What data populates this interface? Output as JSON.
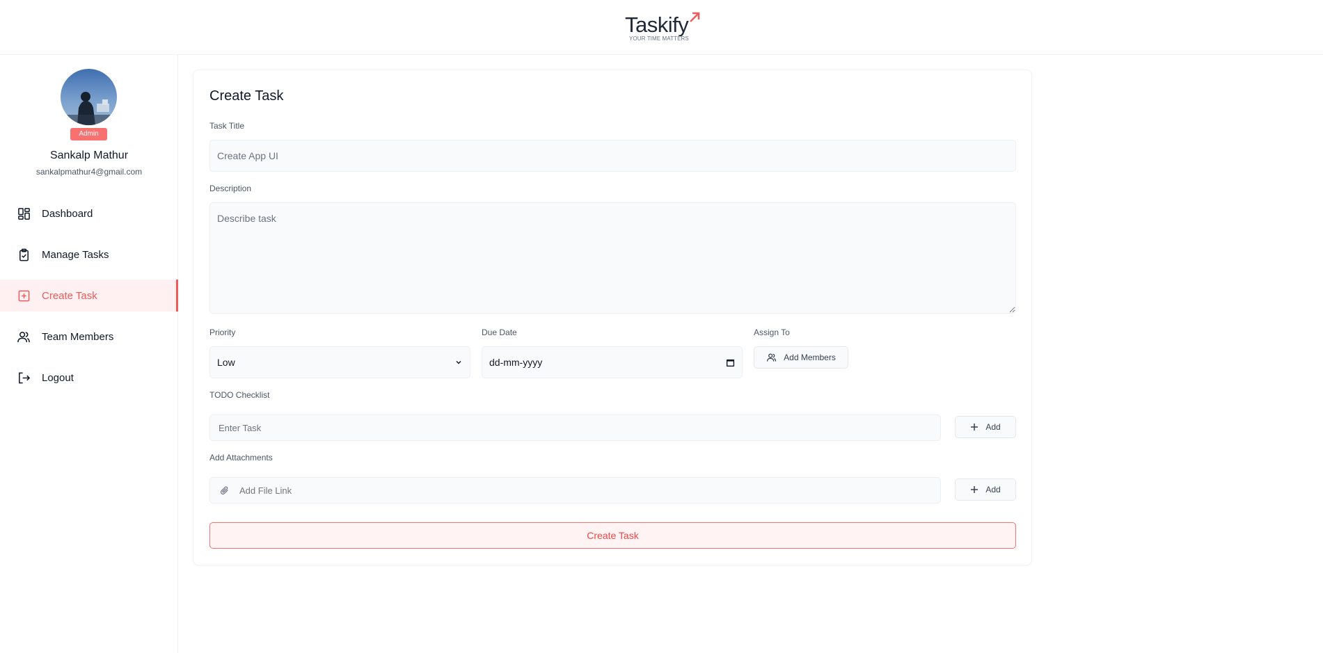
{
  "brand": {
    "name": "Taskify",
    "tagline": "YOUR TIME MATTERS",
    "accent_color": "#f15a5a"
  },
  "user": {
    "role": "Admin",
    "name": "Sankalp Mathur",
    "email": "sankalpmathur4@gmail.com"
  },
  "sidebar": {
    "items": [
      {
        "label": "Dashboard",
        "icon": "dashboard-icon",
        "active": false
      },
      {
        "label": "Manage Tasks",
        "icon": "clipboard-check-icon",
        "active": false
      },
      {
        "label": "Create Task",
        "icon": "plus-square-icon",
        "active": true
      },
      {
        "label": "Team Members",
        "icon": "users-icon",
        "active": false
      },
      {
        "label": "Logout",
        "icon": "logout-icon",
        "active": false
      }
    ]
  },
  "form": {
    "title": "Create Task",
    "task_title": {
      "label": "Task Title",
      "placeholder": "Create App UI",
      "value": ""
    },
    "description": {
      "label": "Description",
      "placeholder": "Describe task",
      "value": ""
    },
    "priority": {
      "label": "Priority",
      "value": "Low"
    },
    "due_date": {
      "label": "Due Date",
      "placeholder": "dd-mm-yyyy"
    },
    "assign_to": {
      "label": "Assign To",
      "button": "Add Members"
    },
    "todo": {
      "label": "TODO Checklist",
      "placeholder": "Enter Task",
      "button": "Add"
    },
    "attachments": {
      "label": "Add Attachments",
      "placeholder": "Add File Link",
      "button": "Add"
    },
    "submit": "Create Task"
  }
}
